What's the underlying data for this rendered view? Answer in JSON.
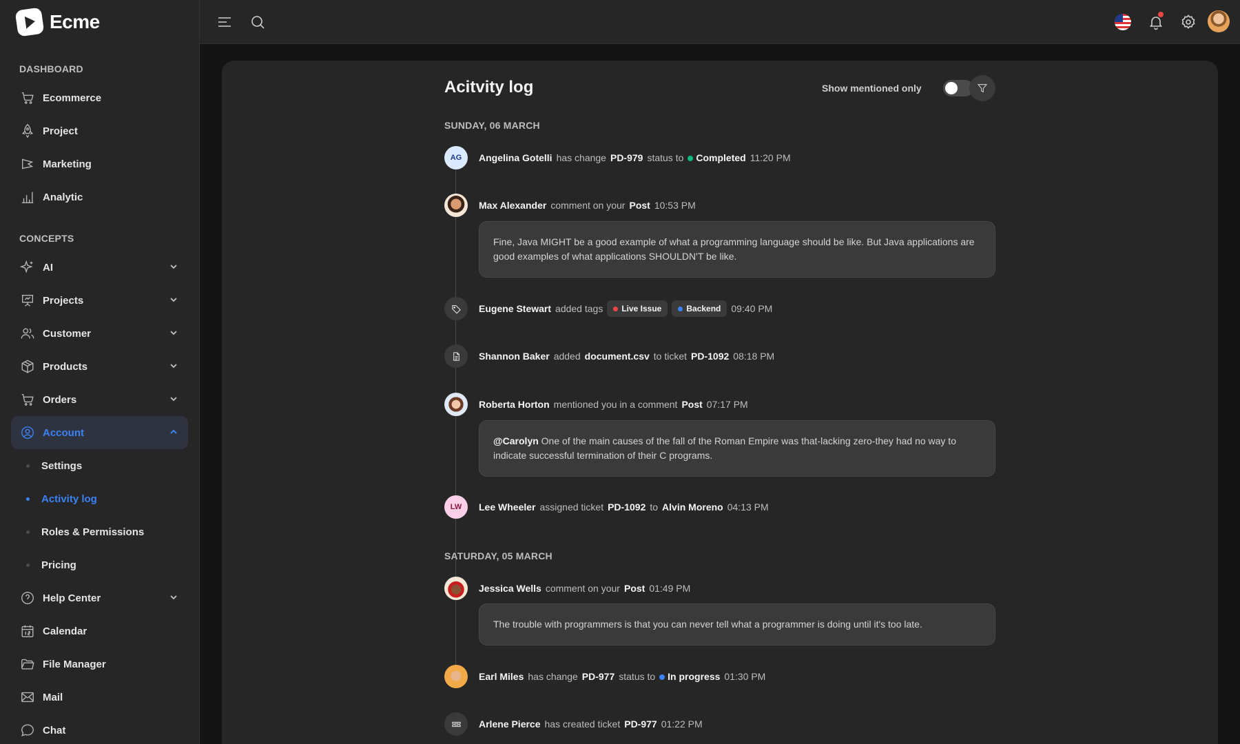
{
  "brand": {
    "name": "Ecme"
  },
  "sidebar": {
    "sections": [
      {
        "title": "DASHBOARD"
      },
      {
        "title": "CONCEPTS"
      }
    ],
    "dashboard_items": [
      {
        "label": "Ecommerce",
        "icon": "cart-icon"
      },
      {
        "label": "Project",
        "icon": "rocket-icon"
      },
      {
        "label": "Marketing",
        "icon": "megaphone-icon"
      },
      {
        "label": "Analytic",
        "icon": "bar-chart-icon"
      }
    ],
    "concept_items": [
      {
        "label": "AI",
        "icon": "sparkle-icon"
      },
      {
        "label": "Projects",
        "icon": "presentation-icon"
      },
      {
        "label": "Customer",
        "icon": "users-icon"
      },
      {
        "label": "Products",
        "icon": "box-icon"
      },
      {
        "label": "Orders",
        "icon": "cart-icon"
      },
      {
        "label": "Account",
        "icon": "user-circle-icon"
      }
    ],
    "account_subitems": [
      {
        "label": "Settings"
      },
      {
        "label": "Activity log"
      },
      {
        "label": "Roles & Permissions"
      },
      {
        "label": "Pricing"
      }
    ],
    "bottom_items": [
      {
        "label": "Help Center",
        "icon": "help-circle-icon"
      },
      {
        "label": "Calendar",
        "icon": "calendar-icon"
      },
      {
        "label": "File Manager",
        "icon": "folder-icon"
      },
      {
        "label": "Mail",
        "icon": "mail-icon"
      },
      {
        "label": "Chat",
        "icon": "chat-icon"
      }
    ]
  },
  "page": {
    "title": "Acitvity log",
    "mention_toggle_label": "Show mentioned only",
    "mention_toggle_on": false
  },
  "groups": [
    {
      "date": "SUNDAY, 06 MARCH"
    },
    {
      "date": "SATURDAY, 05 MARCH"
    }
  ],
  "entries": {
    "e1": {
      "user": "Angelina Gotelli",
      "initials": "AG",
      "action": "has change",
      "ticket": "PD-979",
      "mid": "status to",
      "status": "Completed",
      "status_color": "#10b981",
      "time": "11:20 PM"
    },
    "e2": {
      "user": "Max Alexander",
      "action": "comment on your",
      "target": "Post",
      "time": "10:53 PM",
      "comment": "Fine, Java MIGHT be a good example of what a programming language should be like. But Java applications are good examples of what applications SHOULDN'T be like."
    },
    "e3": {
      "user": "Eugene Stewart",
      "action": "added tags",
      "tags": [
        {
          "label": "Live Issue",
          "color": "#ef4444"
        },
        {
          "label": "Backend",
          "color": "#3b82f6"
        }
      ],
      "time": "09:40 PM"
    },
    "e4": {
      "user": "Shannon Baker",
      "action": "added",
      "file": "document.csv",
      "mid": "to ticket",
      "ticket": "PD-1092",
      "time": "08:18 PM"
    },
    "e5": {
      "user": "Roberta Horton",
      "action": "mentioned you in a comment",
      "target": "Post",
      "time": "07:17 PM",
      "mention": "@Carolyn",
      "comment": "One of the main causes of the fall of the Roman Empire was that-lacking zero-they had no way to indicate successful termination of their C programs."
    },
    "e6": {
      "user": "Lee Wheeler",
      "initials": "LW",
      "action": "assigned ticket",
      "ticket": "PD-1092",
      "mid": "to",
      "assignee": "Alvin Moreno",
      "time": "04:13 PM"
    },
    "e7": {
      "user": "Jessica Wells",
      "action": "comment on your",
      "target": "Post",
      "time": "01:49 PM",
      "comment": "The trouble with programmers is that you can never tell what a programmer is doing until it's too late."
    },
    "e8": {
      "user": "Earl Miles",
      "action": "has change",
      "ticket": "PD-977",
      "mid": "status to",
      "status": "In progress",
      "status_color": "#3b82f6",
      "time": "01:30 PM"
    },
    "e9": {
      "user": "Arlene Pierce",
      "action": "has created ticket",
      "ticket": "PD-977",
      "time": "01:22 PM"
    }
  }
}
